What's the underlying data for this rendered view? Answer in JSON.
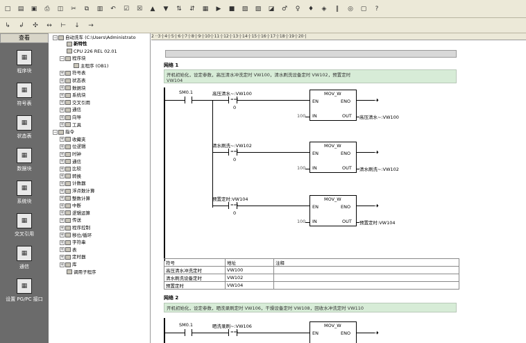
{
  "toolbar": {
    "row1_icons": [
      "new-icon",
      "open-icon",
      "save-icon",
      "print-icon",
      "print-preview-icon",
      "cut-icon",
      "copy-icon",
      "paste-icon",
      "undo-icon",
      "compile-icon",
      "compile-all-icon",
      "upload-icon",
      "download-icon",
      "sort-asc-icon",
      "sort-desc-icon",
      "options-icon",
      "run-icon",
      "stop-icon",
      "status-chart-icon",
      "program-status-icon",
      "trend-icon",
      "force-icon",
      "unforce-icon",
      "read-all-icon",
      "write-all-icon",
      "contact-icon",
      "coil-icon",
      "box-icon",
      "help-icon"
    ],
    "row2_icons": [
      "network-insert-icon",
      "network-delete-icon",
      "cross-ref-icon",
      "element-icon",
      "branch-icon",
      "line-icon",
      "arrow-icon"
    ]
  },
  "nav": {
    "header": "查看",
    "items": [
      {
        "label": "程序块",
        "icon": "program-block-icon"
      },
      {
        "label": "符号表",
        "icon": "symbol-table-icon"
      },
      {
        "label": "状态表",
        "icon": "status-table-icon"
      },
      {
        "label": "数据块",
        "icon": "data-block-icon"
      },
      {
        "label": "系统块",
        "icon": "system-block-icon"
      },
      {
        "label": "交叉引用",
        "icon": "cross-reference-icon"
      },
      {
        "label": "通信",
        "icon": "communication-icon"
      },
      {
        "label": "设置 PG/PC 接口",
        "icon": "pgpc-interface-icon"
      }
    ]
  },
  "tree": {
    "project": "自动洗车 (C:\\Users\\Administrato",
    "items": [
      {
        "label": "新特性",
        "level": 1,
        "bold": true
      },
      {
        "label": "CPU 226 REL 02.01",
        "level": 1
      },
      {
        "label": "程序块",
        "level": 1,
        "expander": "−"
      },
      {
        "label": "主程序 (OB1)",
        "level": 2
      },
      {
        "label": "符号表",
        "level": 1,
        "expander": "+"
      },
      {
        "label": "状态表",
        "level": 1,
        "expander": "+"
      },
      {
        "label": "数据块",
        "level": 1,
        "expander": "+"
      },
      {
        "label": "系统块",
        "level": 1,
        "expander": "+"
      },
      {
        "label": "交叉引用",
        "level": 1,
        "expander": "+"
      },
      {
        "label": "通信",
        "level": 1,
        "expander": "+"
      },
      {
        "label": "向导",
        "level": 1,
        "expander": "+"
      },
      {
        "label": "工具",
        "level": 1,
        "expander": "+"
      },
      {
        "label": "指令",
        "level": 0,
        "expander": "−"
      },
      {
        "label": "收藏夹",
        "level": 1,
        "expander": "+"
      },
      {
        "label": "位逻辑",
        "level": 1,
        "expander": "+"
      },
      {
        "label": "时钟",
        "level": 1,
        "expander": "+"
      },
      {
        "label": "通信",
        "level": 1,
        "expander": "+"
      },
      {
        "label": "比较",
        "level": 1,
        "expander": "+"
      },
      {
        "label": "转换",
        "level": 1,
        "expander": "+"
      },
      {
        "label": "计数器",
        "level": 1,
        "expander": "+"
      },
      {
        "label": "浮点数计算",
        "level": 1,
        "expander": "+"
      },
      {
        "label": "整数计算",
        "level": 1,
        "expander": "+"
      },
      {
        "label": "中断",
        "level": 1,
        "expander": "+"
      },
      {
        "label": "逻辑运算",
        "level": 1,
        "expander": "+"
      },
      {
        "label": "传送",
        "level": 1,
        "expander": "+"
      },
      {
        "label": "程序控制",
        "level": 1,
        "expander": "+"
      },
      {
        "label": "移位/循环",
        "level": 1,
        "expander": "+"
      },
      {
        "label": "字符串",
        "level": 1,
        "expander": "+"
      },
      {
        "label": "表",
        "level": 1,
        "expander": "+"
      },
      {
        "label": "定时器",
        "level": 1,
        "expander": "+"
      },
      {
        "label": "库",
        "level": 1,
        "expander": "+"
      },
      {
        "label": "调用子程序",
        "level": 1
      }
    ]
  },
  "ruler": "·3·|·4·|·5·|·6·|·7·|·8·|·9·|·10·|·11·|·12·|·13·|·14·|·15·|·16·|·17·|·18·|·19·|·20·|",
  "ruler_start": "2 ·",
  "network1": {
    "title": "网络 1",
    "comment1": "开机初始化，设定参数，高压清水冲洗定时    VW100，清水刷洗设备定时              VW102，预置定时",
    "comment2": "VW104",
    "contact": "SM0.1",
    "rows": [
      {
        "cmp_symbol": "高压清水~:VW100",
        "cmp_op": "==I",
        "cmp_val": "0",
        "box": "MOV_W",
        "en": "EN",
        "eno": "ENO",
        "in": "IN",
        "out": "OUT",
        "in_val": "100",
        "out_val": "高压清水~:VW100"
      },
      {
        "cmp_symbol": "清水刷洗~:VW102",
        "cmp_op": "==I",
        "cmp_val": "0",
        "box": "MOV_W",
        "en": "EN",
        "eno": "ENO",
        "in": "IN",
        "out": "OUT",
        "in_val": "100",
        "out_val": "清水刷洗~:VW102"
      },
      {
        "cmp_symbol": "预置定时:VW104",
        "cmp_op": "==I",
        "cmp_val": "0",
        "box": "MOV_W",
        "en": "EN",
        "eno": "ENO",
        "in": "IN",
        "out": "OUT",
        "in_val": "100",
        "out_val": "预置定时:VW104"
      }
    ],
    "symbol_table": {
      "headers": [
        "符号",
        "地址",
        "注释"
      ],
      "rows": [
        [
          "高压清水冲洗定时",
          "VW100",
          ""
        ],
        [
          "清水刷洗设备定时",
          "VW102",
          ""
        ],
        [
          "预置定时",
          "VW104",
          ""
        ]
      ]
    }
  },
  "network2": {
    "title": "网络 2",
    "comment": "开机初始化，设定参数，晒洗录刷定时         VW106，干燥设备定时           VW108，回收水冲洗定时    VW110",
    "contact": "SM0.1",
    "cmp_symbol": "晒洗录刷~:VW106",
    "cmp_op": "==I",
    "box": "MOV_W",
    "en": "EN",
    "eno": "ENO"
  }
}
